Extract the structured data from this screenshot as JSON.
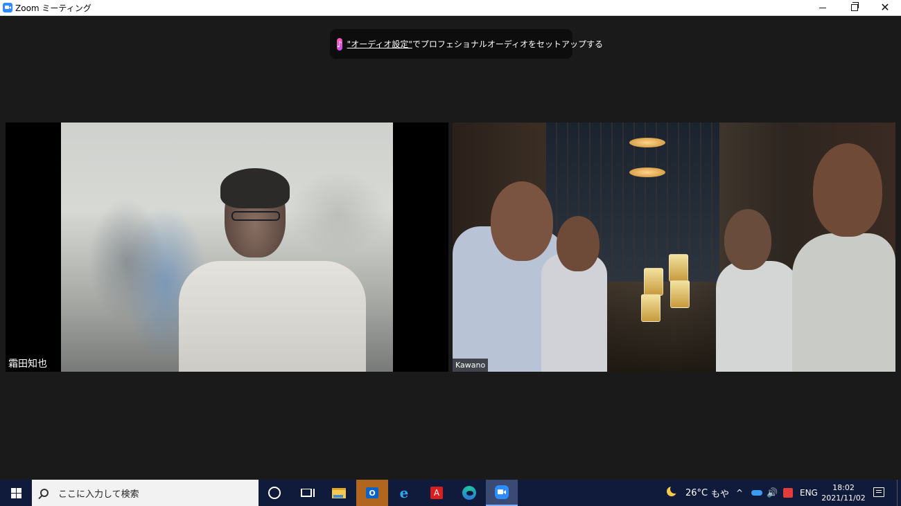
{
  "window": {
    "title": "Zoom ミーティング",
    "minimize_label": "",
    "maximize_label": "",
    "close_label": "✕"
  },
  "notification": {
    "link": "\"オーディオ設定\"",
    "text": "でプロフェショナルオーディオをセットアップする"
  },
  "participants": [
    {
      "name": "霜田知也"
    },
    {
      "name": "Kawano"
    }
  ],
  "taskbar": {
    "search_placeholder": "ここに入力して検索",
    "apps": [
      "start-icon",
      "cortana-icon",
      "task-view-icon",
      "file-explorer-icon",
      "outlook-icon",
      "internet-explorer-icon",
      "acrobat-icon",
      "edge-icon",
      "zoom-icon"
    ],
    "weather": {
      "temperature": "26°C",
      "condition": "もや"
    },
    "tray": {
      "chevron": "^",
      "volume": "🔊",
      "language": "ENG"
    },
    "clock": {
      "time": "18:02",
      "date": "2021/11/02"
    }
  },
  "colors": {
    "background": "#1a1a1a",
    "taskbar": "#101a3a",
    "zoom_blue": "#2d8cff"
  }
}
